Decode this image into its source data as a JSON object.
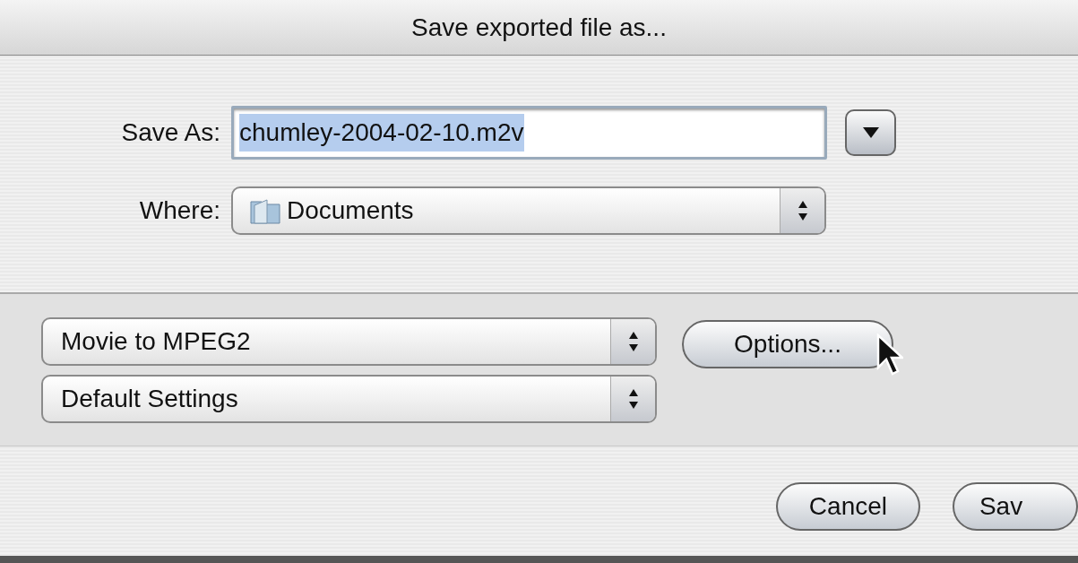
{
  "window": {
    "title": "Save exported file as..."
  },
  "save_as": {
    "label": "Save As:",
    "value": "chumley-2004-02-10.m2v",
    "text_selected": true
  },
  "where": {
    "label": "Where:",
    "value": "Documents"
  },
  "export_popups": [
    {
      "value": "Movie to MPEG2"
    },
    {
      "value": "Default Settings"
    }
  ],
  "options_button": {
    "label": "Options..."
  },
  "buttons": [
    {
      "label": "Cancel"
    },
    {
      "label": "Sav"
    }
  ]
}
